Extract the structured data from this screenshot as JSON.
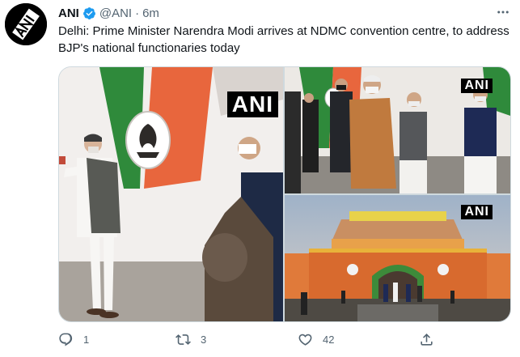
{
  "tweet": {
    "author": {
      "name": "ANI",
      "handle": "@ANI",
      "verified": true,
      "avatar_label": "ANI"
    },
    "separator": "·",
    "time": "6m",
    "text": "Delhi: Prime Minister Narendra Modi arrives at NDMC convention centre, to address BJP's national functionaries today",
    "media": [
      {
        "watermark": "ANI"
      },
      {
        "watermark": "ANI"
      },
      {
        "watermark": "ANI"
      }
    ],
    "actions": {
      "reply_count": "1",
      "retweet_count": "3",
      "like_count": "42"
    }
  },
  "colors": {
    "text": "#0f1419",
    "secondary": "#536471",
    "verified": "#1d9bf0",
    "border": "#cfd9de"
  },
  "icons": [
    "more-icon",
    "verified-badge-icon",
    "reply-icon",
    "retweet-icon",
    "like-icon",
    "share-icon"
  ]
}
